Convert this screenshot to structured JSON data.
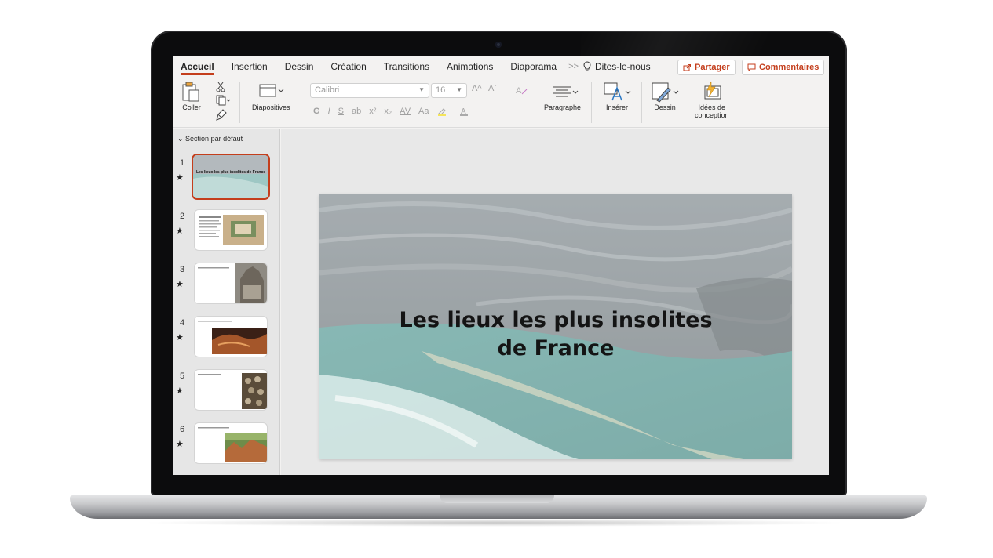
{
  "tabs": [
    "Accueil",
    "Insertion",
    "Dessin",
    "Création",
    "Transitions",
    "Animations",
    "Diaporama"
  ],
  "tab_more": ">>",
  "tell_me": "Dites-le-nous",
  "share_label": "Partager",
  "comments_label": "Commentaires",
  "ribbon": {
    "paste_label": "Coller",
    "slides_label": "Diapositives",
    "font_name": "Calibri",
    "font_size": "16",
    "paragraph_label": "Paragraphe",
    "insert_label": "Insérer",
    "draw_label": "Dessin",
    "design_ideas_label_1": "Idées de",
    "design_ideas_label_2": "conception",
    "fmt_bold": "G",
    "fmt_italic": "I",
    "fmt_underline": "S",
    "fmt_strike": "ab",
    "fmt_super": "x²",
    "fmt_sub": "x₂",
    "fmt_spacing": "AV",
    "fmt_case": "Aa",
    "grow_font": "A^",
    "shrink_font": "Aˇ"
  },
  "panel": {
    "section_title": "Section par défaut",
    "slides": [
      {
        "num": "1",
        "title": "Les lieux les plus insolites de France"
      },
      {
        "num": "2"
      },
      {
        "num": "3"
      },
      {
        "num": "4"
      },
      {
        "num": "5"
      },
      {
        "num": "6"
      }
    ]
  },
  "slide": {
    "title_line1": "Les lieux les plus insolites",
    "title_line2": "de France"
  },
  "colors": {
    "accent": "#c43e1c",
    "water": "#3f8d87"
  },
  "icons": {
    "star": "★"
  }
}
